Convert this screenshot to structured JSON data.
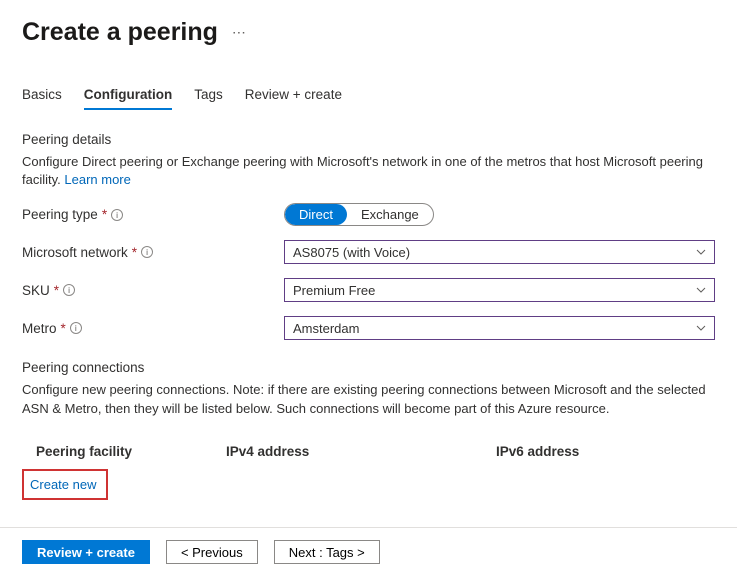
{
  "header": {
    "title": "Create a peering"
  },
  "tabs": [
    "Basics",
    "Configuration",
    "Tags",
    "Review + create"
  ],
  "activeTab": "Configuration",
  "peeringDetails": {
    "heading": "Peering details",
    "desc": "Configure Direct peering or Exchange peering with Microsoft's network in one of the metros that host Microsoft peering facility. ",
    "learnMore": "Learn more"
  },
  "fields": {
    "peeringType": {
      "label": "Peering type",
      "options": [
        "Direct",
        "Exchange"
      ],
      "value": "Direct"
    },
    "microsoftNetwork": {
      "label": "Microsoft network",
      "value": "AS8075 (with Voice)"
    },
    "sku": {
      "label": "SKU",
      "value": "Premium Free"
    },
    "metro": {
      "label": "Metro",
      "value": "Amsterdam"
    }
  },
  "connections": {
    "heading": "Peering connections",
    "desc": "Configure new peering connections. Note: if there are existing peering connections between Microsoft and the selected ASN & Metro, then they will be listed below. Such connections will become part of this Azure resource.",
    "columns": [
      "Peering facility",
      "IPv4 address",
      "IPv6 address"
    ],
    "createNew": "Create new"
  },
  "footer": {
    "review": "Review + create",
    "previous": "< Previous",
    "next": "Next : Tags >"
  }
}
